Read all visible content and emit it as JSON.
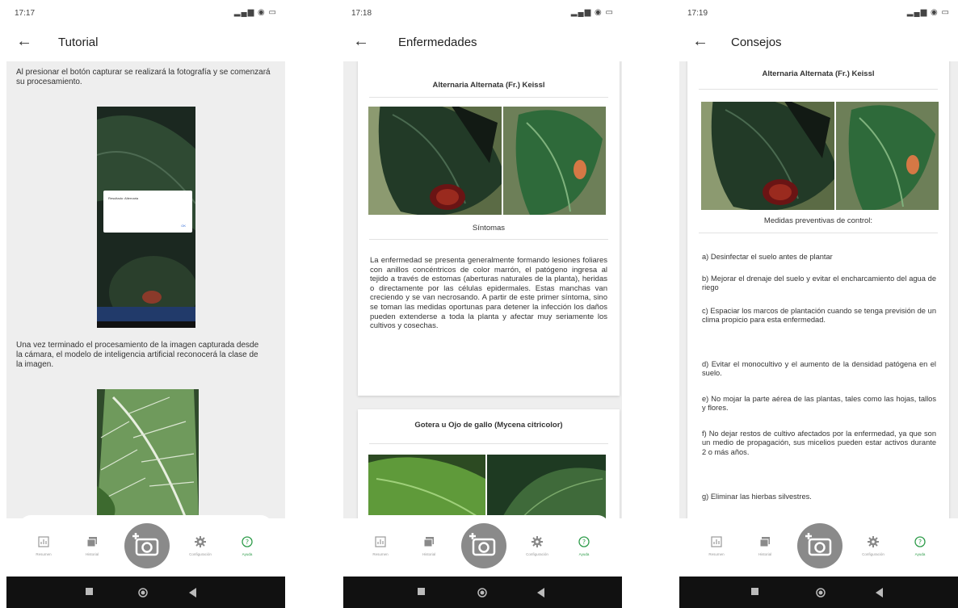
{
  "screens": [
    {
      "status": {
        "time": "17:17"
      },
      "title": "Tutorial",
      "text1": "Al presionar el botón capturar se realizará la fotografía y se comenzará su procesamiento.",
      "dialog_title": "Resultado: Alternaria",
      "text2": "Una vez terminado el procesamiento de la imagen capturada desde la cámara, el modelo de inteligencia artificial reconocerá la clase de la imagen."
    },
    {
      "status": {
        "time": "17:18"
      },
      "title": "Enfermedades",
      "card1": {
        "title": "Alternaria Alternata (Fr.) Keissl",
        "caption": "Síntomas",
        "body": "La enfermedad se presenta generalmente formando lesiones foliares con anillos concéntricos de color marrón, el patógeno ingresa al tejido a través de estomas (aberturas naturales de la planta), heridas o directamente por las células epidermales. Estas manchas van creciendo y se van necrosando. A partir de este primer síntoma, sino se toman las medidas oportunas para detener la infección los daños pueden extenderse a toda la planta y afectar muy seriamente los cultivos y cosechas."
      },
      "card2": {
        "title": "Gotera u Ojo de gallo (Mycena citricolor)"
      }
    },
    {
      "status": {
        "time": "17:19"
      },
      "title": "Consejos",
      "card_title": "Alternaria Alternata (Fr.) Keissl",
      "caption": "Medidas preventivas de control:",
      "measures": [
        "a) Desinfectar el suelo antes de plantar",
        "b) Mejorar el drenaje del suelo y evitar el encharcamiento del agua de riego",
        "c) Espaciar los marcos de plantación cuando se tenga previsión de un clima propicio para esta enfermedad.",
        "d) Evitar el monocultivo y el aumento de la densidad patógena en el suelo.",
        "e) No mojar la parte aérea de las plantas, tales como las hojas, tallos y flores.",
        "f) No dejar restos de cultivo afectados por la enfermedad, ya que son un medio de propagación, sus micelios pueden estar activos durante 2 o más años.",
        "g) Eliminar las hierbas silvestres."
      ]
    }
  ],
  "nav": {
    "items": [
      "Resumen",
      "Historial",
      "Configuración",
      "Ayuda"
    ],
    "active": "Ayuda"
  },
  "colors": {
    "active": "#2e9c4a",
    "leaf_dark": "#1f3d25",
    "leaf_green": "#4c8a36",
    "lesion": "#8a1f1a"
  },
  "icons": [
    "back-arrow-icon",
    "chart-icon",
    "gallery-icon",
    "camera-icon",
    "gear-icon",
    "help-circle-icon",
    "square-icon",
    "circle-icon",
    "triangle-back-icon",
    "wifi-icon",
    "battery-icon",
    "signal-icon"
  ]
}
